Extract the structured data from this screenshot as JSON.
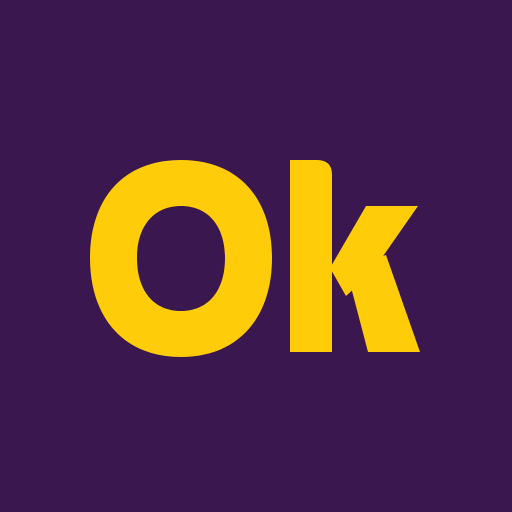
{
  "logo": {
    "text": "Ok",
    "background_color": "#3a174e",
    "text_color": "#fecc08"
  }
}
